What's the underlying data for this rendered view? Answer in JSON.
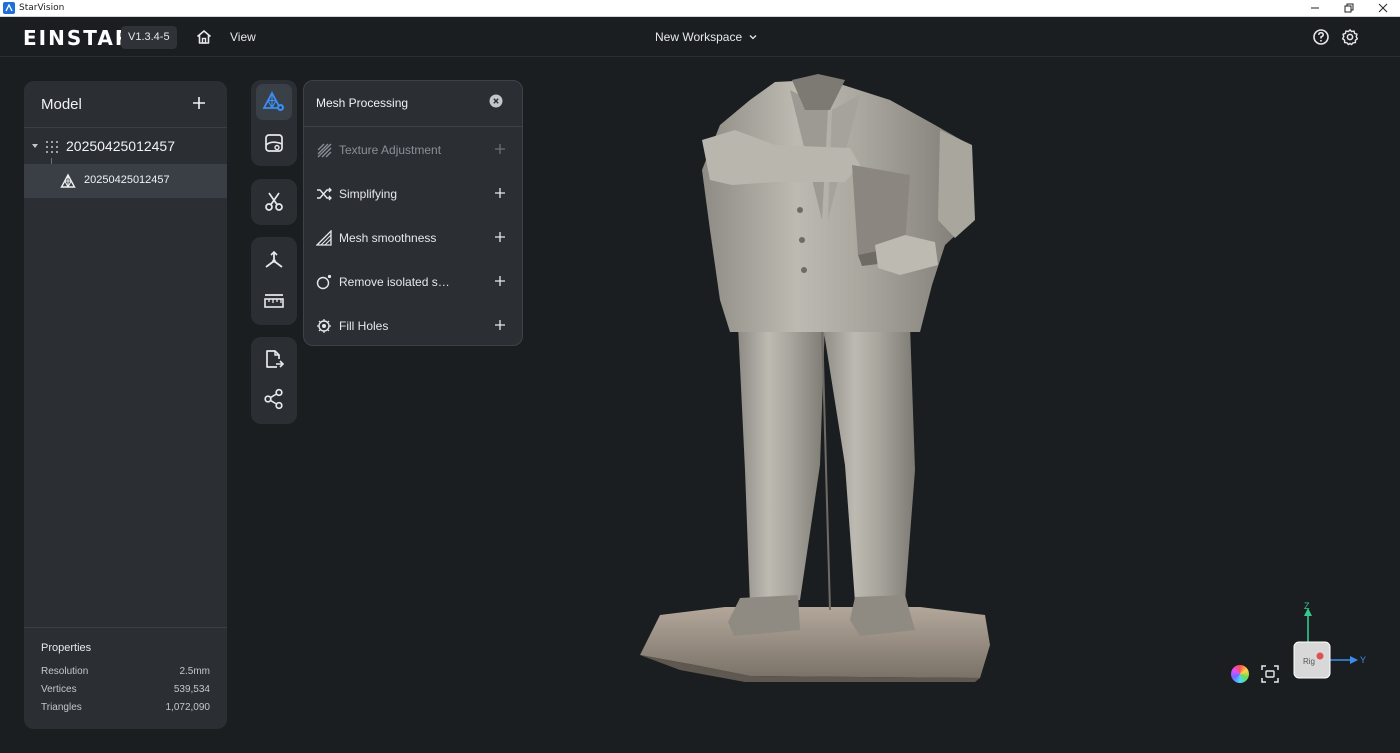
{
  "os": {
    "title": "StarVision"
  },
  "header": {
    "brand": "EINSTAR",
    "version": "V1.3.4-5",
    "view_label": "View",
    "workspace_label": "New Workspace"
  },
  "model_panel": {
    "title": "Model",
    "tree": {
      "parent_label": "20250425012457",
      "child_label": "20250425012457"
    },
    "properties": {
      "title": "Properties",
      "rows": [
        {
          "label": "Resolution",
          "value": "2.5mm"
        },
        {
          "label": "Vertices",
          "value": "539,534"
        },
        {
          "label": "Triangles",
          "value": "1,072,090"
        }
      ]
    }
  },
  "mesh_processing": {
    "title": "Mesh Processing",
    "items": [
      {
        "label": "Texture Adjustment",
        "icon": "texture-icon",
        "enabled": false
      },
      {
        "label": "Simplifying",
        "icon": "shuffle-icon",
        "enabled": true
      },
      {
        "label": "Mesh smoothness",
        "icon": "smooth-icon",
        "enabled": true
      },
      {
        "label": "Remove isolated s…",
        "icon": "isolated-icon",
        "enabled": true
      },
      {
        "label": "Fill Holes",
        "icon": "fill-holes-icon",
        "enabled": true
      }
    ]
  },
  "colors": {
    "accent": "#3b8df0",
    "panel": "#2b2f34",
    "background": "#1b1e21"
  },
  "axis": {
    "z_label": "Z",
    "y_label": "Y",
    "cube_face": "Rig"
  }
}
